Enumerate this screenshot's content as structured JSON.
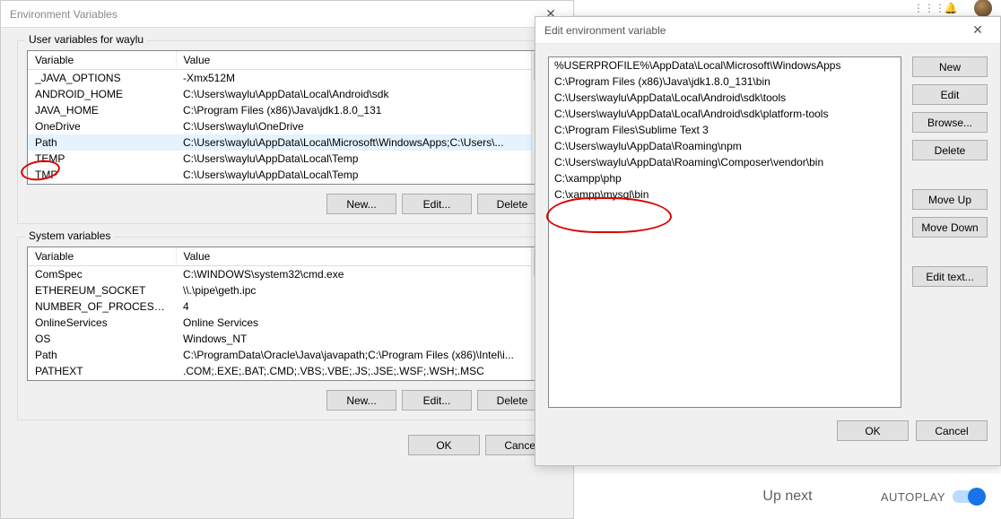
{
  "envDialog": {
    "title": "Environment Variables",
    "userVarsLabel": "User variables for waylu",
    "sysVarsLabel": "System variables",
    "col_variable": "Variable",
    "col_value": "Value",
    "btn_new": "New...",
    "btn_edit": "Edit...",
    "btn_delete": "Delete",
    "btn_ok": "OK",
    "btn_cancel": "Cancel",
    "userVars": [
      {
        "name": "_JAVA_OPTIONS",
        "value": "-Xmx512M"
      },
      {
        "name": "ANDROID_HOME",
        "value": "C:\\Users\\waylu\\AppData\\Local\\Android\\sdk"
      },
      {
        "name": "JAVA_HOME",
        "value": "C:\\Program Files (x86)\\Java\\jdk1.8.0_131"
      },
      {
        "name": "OneDrive",
        "value": "C:\\Users\\waylu\\OneDrive"
      },
      {
        "name": "Path",
        "value": "C:\\Users\\waylu\\AppData\\Local\\Microsoft\\WindowsApps;C:\\Users\\..."
      },
      {
        "name": "TEMP",
        "value": "C:\\Users\\waylu\\AppData\\Local\\Temp"
      },
      {
        "name": "TMP",
        "value": "C:\\Users\\waylu\\AppData\\Local\\Temp"
      }
    ],
    "userSelectedIndex": 4,
    "sysVars": [
      {
        "name": "ComSpec",
        "value": "C:\\WINDOWS\\system32\\cmd.exe"
      },
      {
        "name": "ETHEREUM_SOCKET",
        "value": "\\\\.\\pipe\\geth.ipc"
      },
      {
        "name": "NUMBER_OF_PROCESSORS",
        "value": "4"
      },
      {
        "name": "OnlineServices",
        "value": "Online Services"
      },
      {
        "name": "OS",
        "value": "Windows_NT"
      },
      {
        "name": "Path",
        "value": "C:\\ProgramData\\Oracle\\Java\\javapath;C:\\Program Files (x86)\\Intel\\i..."
      },
      {
        "name": "PATHEXT",
        "value": ".COM;.EXE;.BAT;.CMD;.VBS;.VBE;.JS;.JSE;.WSF;.WSH;.MSC"
      }
    ]
  },
  "editDialog": {
    "title": "Edit environment variable",
    "items": [
      "%USERPROFILE%\\AppData\\Local\\Microsoft\\WindowsApps",
      "C:\\Program Files (x86)\\Java\\jdk1.8.0_131\\bin",
      "C:\\Users\\waylu\\AppData\\Local\\Android\\sdk\\tools",
      "C:\\Users\\waylu\\AppData\\Local\\Android\\sdk\\platform-tools",
      "C:\\Program Files\\Sublime Text 3",
      "C:\\Users\\waylu\\AppData\\Roaming\\npm",
      "C:\\Users\\waylu\\AppData\\Roaming\\Composer\\vendor\\bin",
      "C:\\xampp\\php",
      "C:\\xampp\\mysql\\bin"
    ],
    "btn_new": "New",
    "btn_edit": "Edit",
    "btn_browse": "Browse...",
    "btn_delete": "Delete",
    "btn_moveup": "Move Up",
    "btn_movedown": "Move Down",
    "btn_edittext": "Edit text...",
    "btn_ok": "OK",
    "btn_cancel": "Cancel"
  },
  "bg": {
    "upnext": "Up next",
    "autoplay": "AUTOPLAY"
  }
}
